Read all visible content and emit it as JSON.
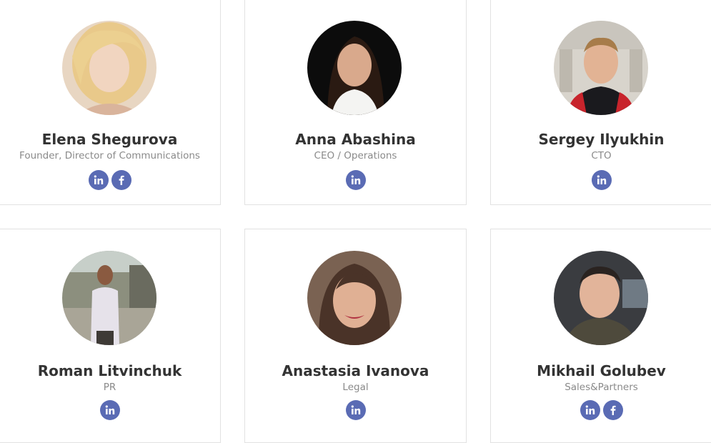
{
  "colors": {
    "accent": "#5a6bb4",
    "name": "#333333",
    "role": "#8a8a8a",
    "border": "#e2e2e2"
  },
  "team": [
    {
      "name": "Elena Shegurova",
      "role": "Founder, Director of Communications",
      "socials": [
        "linkedin-icon",
        "facebook-icon"
      ]
    },
    {
      "name": "Anna Abashina",
      "role": "CEO / Operations",
      "socials": [
        "linkedin-icon"
      ]
    },
    {
      "name": "Sergey Ilyukhin",
      "role": "CTO",
      "socials": [
        "linkedin-icon"
      ]
    },
    {
      "name": "Roman Litvinchuk",
      "role": "PR",
      "socials": [
        "linkedin-icon"
      ]
    },
    {
      "name": "Anastasia Ivanova",
      "role": "Legal",
      "socials": [
        "linkedin-icon"
      ]
    },
    {
      "name": "Mikhail Golubev",
      "role": "Sales&Partners",
      "socials": [
        "linkedin-icon",
        "facebook-icon"
      ]
    }
  ]
}
